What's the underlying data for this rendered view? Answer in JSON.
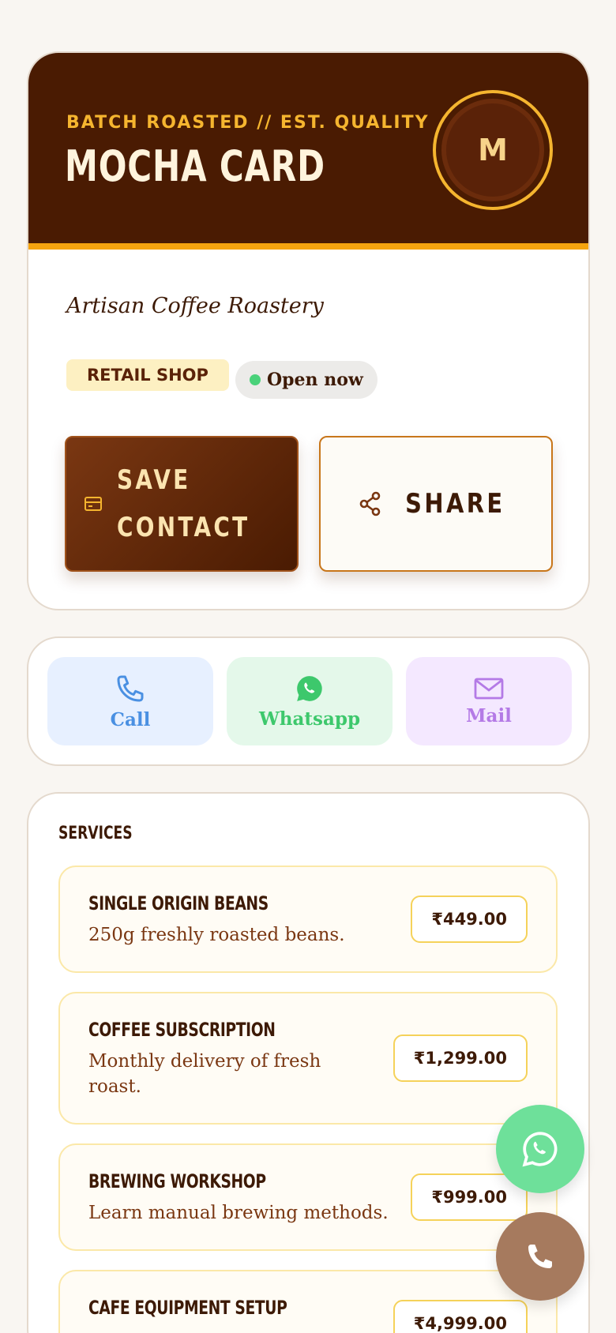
{
  "header": {
    "eyebrow": "BATCH ROASTED // EST. QUALITY",
    "brand": "MOCHA CARD",
    "avatar_initial": "M",
    "tagline": "Artisan Coffee Roastery",
    "category_badge": "RETAIL SHOP",
    "status_badge": "Open now"
  },
  "actions": {
    "save_line1": "SAVE",
    "save_line2": "CONTACT",
    "share_label": "SHARE",
    "save_icon": "id-card-icon",
    "share_icon": "share-icon"
  },
  "quick_actions": [
    {
      "label": "Call",
      "icon": "phone-icon",
      "color": "#4a90e2"
    },
    {
      "label": "Whatsapp",
      "icon": "whatsapp-icon",
      "color": "#3dc86c"
    },
    {
      "label": "Mail",
      "icon": "mail-icon",
      "color": "#b47ae6"
    }
  ],
  "services": {
    "title": "SERVICES",
    "items": [
      {
        "name": "SINGLE ORIGIN BEANS",
        "desc_line1": "250g freshly roasted beans.",
        "desc_line2": "",
        "price": "₹449.00"
      },
      {
        "name": "COFFEE SUBSCRIPTION",
        "desc_line1": "Monthly delivery of fresh",
        "desc_line2": "roast.",
        "price": "₹1,299.00"
      },
      {
        "name": "BREWING WORKSHOP",
        "desc_line1": "Learn manual brewing methods.",
        "desc_line2": "",
        "price": "₹999.00"
      },
      {
        "name": "CAFE EQUIPMENT SETUP",
        "desc_line1": "",
        "desc_line2": "",
        "price": "₹4,999.00"
      }
    ]
  },
  "floating": {
    "whatsapp_icon": "whatsapp-icon",
    "call_icon": "phone-icon"
  },
  "colors": {
    "header_bg": "#4a1b02",
    "accent": "#f5a40f",
    "cream": "#fff4dd"
  }
}
